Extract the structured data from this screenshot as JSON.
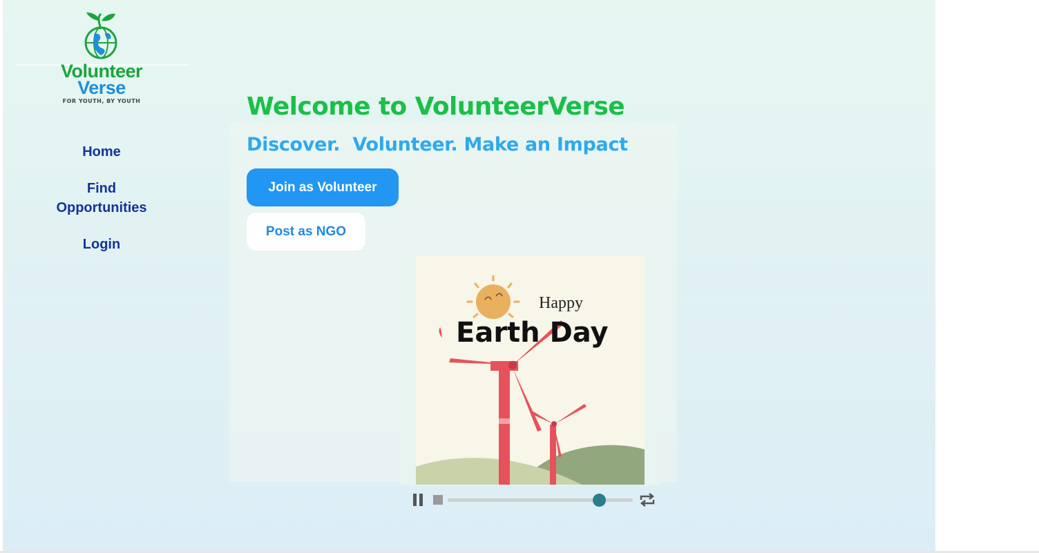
{
  "brand": {
    "word_one": "Volunteer",
    "word_two": "Verse",
    "tagline": "FOR YOUTH, BY YOUTH",
    "colors": {
      "green": "#1aa53b",
      "blue": "#1e8fd8"
    }
  },
  "nav": {
    "items": [
      {
        "label": "Home"
      },
      {
        "label": "Find Opportunities"
      },
      {
        "label": "Login"
      }
    ]
  },
  "hero": {
    "title": "Welcome to VolunteerVerse",
    "subtitle": "Discover.  Volunteer. Make an Impact",
    "primary_button": "Join as Volunteer",
    "secondary_button": "Post as NGO"
  },
  "media": {
    "image_text_small": "Happy",
    "image_text_large": "Earth Day",
    "player": {
      "pause_icon": "pause-icon",
      "stop_icon": "stop-icon",
      "loop_icon": "loop-icon",
      "progress": 0.82
    }
  },
  "colors": {
    "title_green": "#1bbf48",
    "subtitle_blue": "#2ea9ee",
    "nav_blue": "#13339c",
    "button_blue": "#2196f3"
  }
}
